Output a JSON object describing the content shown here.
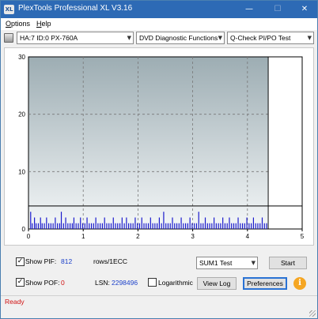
{
  "window": {
    "title": "PlexTools Professional XL V3.16",
    "app_icon_text": "XL",
    "minimize_glyph": "—",
    "maximize_glyph": "☐",
    "close_glyph": "✕"
  },
  "menu": {
    "items": [
      {
        "mnemonic": "O",
        "rest": "ptions"
      },
      {
        "mnemonic": "H",
        "rest": "elp"
      }
    ]
  },
  "toolbar": {
    "drive": "HA:7 ID:0  PX-760A",
    "function": "DVD Diagnostic Functions",
    "test": "Q-Check PI/PO Test",
    "arrow_glyph": "▼"
  },
  "chart_data": {
    "type": "bar",
    "x_ticks": [
      0,
      1,
      2,
      3,
      4,
      5
    ],
    "y_ticks": [
      0,
      10,
      20,
      30
    ],
    "xlim": [
      0,
      5
    ],
    "ylim": [
      0,
      30
    ],
    "grid": true,
    "threshold_line": 4,
    "end_marker_x": 4.38,
    "series": [
      {
        "color": "#1a1acc",
        "x": [
          0.04,
          0.07,
          0.11,
          0.14,
          0.18,
          0.22,
          0.25,
          0.29,
          0.33,
          0.37,
          0.41,
          0.45,
          0.49,
          0.53,
          0.57,
          0.6,
          0.64,
          0.68,
          0.72,
          0.76,
          0.8,
          0.83,
          0.87,
          0.91,
          0.95,
          0.99,
          1.03,
          1.07,
          1.11,
          1.15,
          1.19,
          1.23,
          1.27,
          1.31,
          1.35,
          1.39,
          1.43,
          1.47,
          1.51,
          1.55,
          1.59,
          1.63,
          1.67,
          1.71,
          1.75,
          1.79,
          1.83,
          1.87,
          1.91,
          1.95,
          1.99,
          2.03,
          2.07,
          2.11,
          2.15,
          2.19,
          2.23,
          2.27,
          2.31,
          2.35,
          2.39,
          2.43,
          2.47,
          2.51,
          2.55,
          2.59,
          2.63,
          2.67,
          2.71,
          2.75,
          2.79,
          2.83,
          2.87,
          2.91,
          2.95,
          2.99,
          3.03,
          3.07,
          3.11,
          3.15,
          3.19,
          3.23,
          3.27,
          3.31,
          3.35,
          3.39,
          3.43,
          3.47,
          3.51,
          3.55,
          3.59,
          3.63,
          3.67,
          3.71,
          3.75,
          3.79,
          3.83,
          3.87,
          3.91,
          3.95,
          3.99,
          4.03,
          4.07,
          4.11,
          4.15,
          4.19,
          4.23,
          4.27,
          4.31,
          4.35
        ],
        "values": [
          3,
          1,
          2,
          1,
          1,
          2,
          1,
          1,
          2,
          1,
          1,
          1,
          2,
          1,
          1,
          3,
          1,
          2,
          1,
          1,
          1,
          2,
          1,
          1,
          2,
          1,
          1,
          2,
          1,
          1,
          1,
          2,
          1,
          1,
          1,
          2,
          1,
          1,
          1,
          2,
          1,
          1,
          1,
          2,
          1,
          2,
          1,
          1,
          1,
          2,
          1,
          1,
          2,
          1,
          1,
          1,
          2,
          1,
          1,
          1,
          2,
          1,
          3,
          1,
          1,
          1,
          2,
          1,
          1,
          1,
          2,
          1,
          1,
          1,
          2,
          1,
          1,
          1,
          3,
          1,
          1,
          2,
          1,
          1,
          1,
          2,
          1,
          1,
          1,
          2,
          1,
          1,
          2,
          1,
          1,
          1,
          2,
          1,
          1,
          1,
          2,
          1,
          1,
          2,
          1,
          1,
          1,
          2,
          1,
          1
        ]
      }
    ]
  },
  "controls": {
    "show_pif_label": "Show PIF:",
    "pif_value": "812",
    "pif_unit": "rows/1ECC",
    "show_pof_label": "Show POF:",
    "pof_value": "0",
    "lsn_label": "LSN:",
    "lsn_value": "2298496",
    "logarithmic_label": "Logarithmic",
    "check_glyph": "✓",
    "test_mode": "SUM1 Test",
    "start_label": "Start",
    "view_log_label": "View Log",
    "preferences_label": "Preferences",
    "info_glyph": "i"
  },
  "status": {
    "text": "Ready"
  }
}
